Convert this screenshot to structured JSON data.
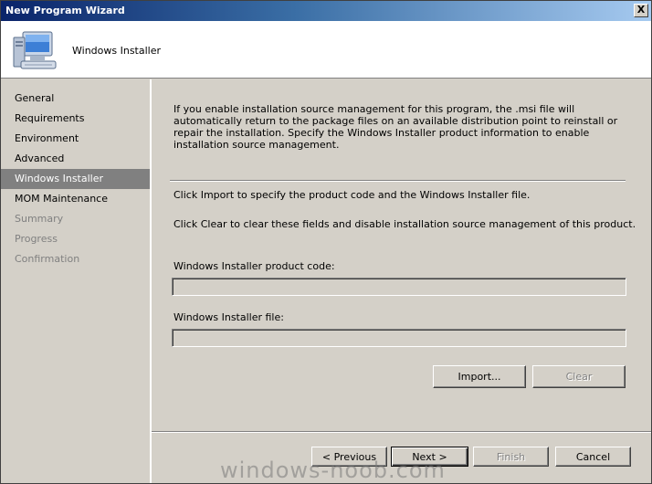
{
  "window": {
    "title": "New Program Wizard",
    "close_glyph": "X"
  },
  "header": {
    "title": "Windows Installer",
    "icon": "computer-icon"
  },
  "sidebar": {
    "items": [
      {
        "label": "General",
        "state": "normal"
      },
      {
        "label": "Requirements",
        "state": "normal"
      },
      {
        "label": "Environment",
        "state": "normal"
      },
      {
        "label": "Advanced",
        "state": "normal"
      },
      {
        "label": "Windows Installer",
        "state": "selected"
      },
      {
        "label": "MOM Maintenance",
        "state": "normal"
      },
      {
        "label": "Summary",
        "state": "disabled"
      },
      {
        "label": "Progress",
        "state": "disabled"
      },
      {
        "label": "Confirmation",
        "state": "disabled"
      }
    ]
  },
  "main": {
    "description": "If you enable installation source management for this program, the .msi file will automatically return to the package files on an available distribution point to reinstall or repair the installation. Specify the Windows Installer product information to enable installation source management.",
    "import_hint": "Click Import to specify the product code and the Windows Installer file.",
    "clear_hint": "Click Clear to clear these fields and disable installation source management of this product.",
    "product_code_label": "Windows Installer product code:",
    "product_code_value": "",
    "file_label": "Windows Installer file:",
    "file_value": "",
    "import_button": "Import...",
    "clear_button": "Clear"
  },
  "footer": {
    "previous_button": "< Previous",
    "next_button": "Next >",
    "finish_button": "Finish",
    "cancel_button": "Cancel"
  },
  "watermark": "windows-noob.com"
}
